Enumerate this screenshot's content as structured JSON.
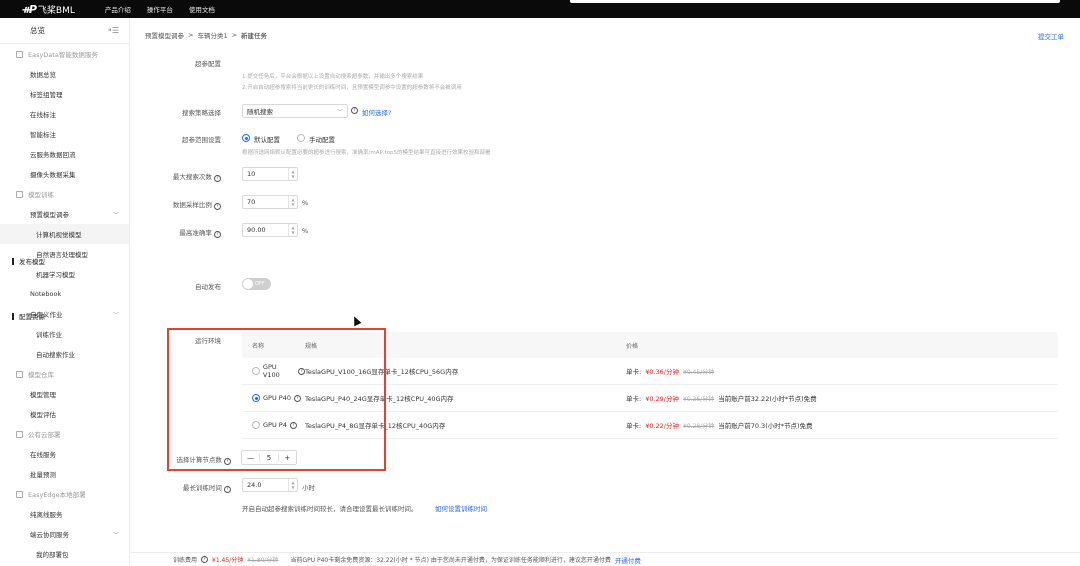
{
  "topbar": {
    "logo_mark": "ᚑP",
    "logo_name": "飞桨BML",
    "nav": [
      "产品介绍",
      "操作平台",
      "使用文档"
    ]
  },
  "sidebar": {
    "title": "总览",
    "sections": [
      {
        "group": "EasyData智能数据服务",
        "items": [
          "数据总览",
          "标签组管理",
          "在线标注",
          "智能标注",
          "云服务数据回流",
          "摄像头数据采集"
        ]
      },
      {
        "group": "模型训练",
        "items": [
          "预置模型调参",
          "计算机视觉模型",
          "自然语言处理模型",
          "机器学习模型",
          "Notebook",
          "自定义作业",
          "训练作业",
          "自动搜索作业"
        ]
      },
      {
        "group": "模型仓库",
        "items": [
          "模型管理",
          "模型评估"
        ]
      },
      {
        "group": "公有云部署",
        "items": [
          "在线服务",
          "批量预测"
        ]
      },
      {
        "group": "EasyEdge本地部署",
        "items": [
          "纯离线服务",
          "端云协同服务",
          "我的部署包"
        ]
      }
    ]
  },
  "breadcrumb": {
    "items": [
      "预置模型调参",
      "车辆分类1"
    ],
    "current": "新建任务",
    "sep": ">"
  },
  "ticket_link": "提交工单",
  "form": {
    "top_label": "超参配置",
    "top_hint1": "1.提交任务后，平台会根据以上设置自动搜索超参数，并输出多个搜索结果",
    "top_hint2": "2.开启自动超参搜索将当前更长的训练时间，且预置模型调参中设置的超参数将不会被调用",
    "search_strategy_label": "搜索策略选择",
    "search_strategy_value": "随机搜索",
    "search_strategy_help": "如何选择?",
    "range_label": "超参范围设置",
    "range_opt_default": "默认配置",
    "range_opt_manual": "手动配置",
    "range_hint": "根据所选网络默认配置必要的超参进行搜索，准确率/mAP top5的模型结果可直接进行效果校验和部署",
    "max_search_label": "最大搜索次数",
    "max_search_value": "10",
    "sample_label": "数据采样比例",
    "sample_value": "70",
    "sample_unit": "%",
    "acc_label": "最高准确率",
    "acc_value": "90.00",
    "acc_unit": "%"
  },
  "publish": {
    "section": "发布模型",
    "auto_label": "自动发布",
    "toggle_text": "OFF"
  },
  "resource": {
    "section": "配置资源",
    "env_label": "运行环境",
    "headers": {
      "name": "名称",
      "spec": "规格",
      "price": "价格"
    },
    "rows": [
      {
        "name": "GPU V100",
        "spec": "TeslaGPU_V100_16G显存单卡_12核CPU_56G内存",
        "unit": "单卡:",
        "price": "¥0.36/分钟",
        "old": "¥0.45/分钟",
        "note": "",
        "selected": false
      },
      {
        "name": "GPU P40",
        "spec": "TeslaGPU_P40_24G显存单卡_12核CPU_40G内存",
        "unit": "单卡:",
        "price": "¥0.29/分钟",
        "old": "¥0.36/分钟",
        "note": "当前账户前32.22(小时*节点)免费",
        "selected": true
      },
      {
        "name": "GPU P4",
        "spec": "TeslaGPU_P4_8G显存单卡_12核CPU_40G内存",
        "unit": "单卡:",
        "price": "¥0.22/分钟",
        "old": "¥0.28/分钟",
        "note": "当前账户前70.3(小时*节点)免费",
        "selected": false
      }
    ],
    "nodes_label": "选择计算节点数",
    "nodes_minus": "—",
    "nodes_value": "5",
    "nodes_plus": "+",
    "maxtime_label": "最长训练时间",
    "maxtime_value": "24.0",
    "maxtime_unit": "小时",
    "maxtime_hint": "开启自动超参搜索训练时间较长，请合理设置最长训练时间。",
    "maxtime_link": "如何设置训练时间"
  },
  "footer": {
    "label": "训练费用",
    "price": "¥1.45/分钟",
    "old": "¥1.80/分钟",
    "note": "当前GPU P40卡剩余免费资源：32.22(小时 * 节点) 由于您尚未开通付费，为保证训练任务能顺利进行，建议您开通付费",
    "link": "开通付费"
  },
  "colors": {
    "accent": "#2468f2",
    "price": "#e02020",
    "highlight": "#e0432f"
  }
}
